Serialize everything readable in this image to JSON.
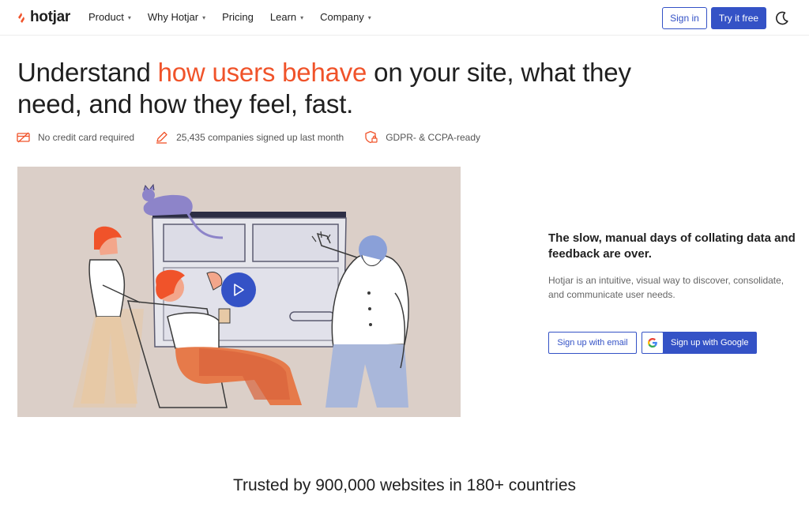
{
  "brand": {
    "name": "hotjar",
    "accent": "#f0532a",
    "primary": "#3452c6"
  },
  "nav": {
    "items": [
      {
        "label": "Product",
        "dropdown": true
      },
      {
        "label": "Why Hotjar",
        "dropdown": true
      },
      {
        "label": "Pricing",
        "dropdown": false
      },
      {
        "label": "Learn",
        "dropdown": true
      },
      {
        "label": "Company",
        "dropdown": true
      }
    ],
    "signin_label": "Sign in",
    "try_label": "Try it free",
    "theme_icon": "moon-icon"
  },
  "hero": {
    "headline_pre": "Understand ",
    "headline_highlight": "how users behave",
    "headline_post": " on your site, what they need, and how they feel, fast.",
    "badges": [
      {
        "icon": "credit-card-icon",
        "label": "No credit card required"
      },
      {
        "icon": "pencil-icon",
        "label": "25,435 companies signed up last month"
      },
      {
        "icon": "shield-lock-icon",
        "label": "GDPR- & CCPA-ready"
      }
    ]
  },
  "media": {
    "play_icon": "play-icon"
  },
  "side": {
    "title": "The slow, manual days of collating data and feedback are over.",
    "description": "Hotjar is an intuitive, visual way to discover, consolidate, and communicate user needs.",
    "email_button": "Sign up with email",
    "google_button": "Sign up with Google"
  },
  "trusted": "Trusted by 900,000 websites in 180+ countries"
}
